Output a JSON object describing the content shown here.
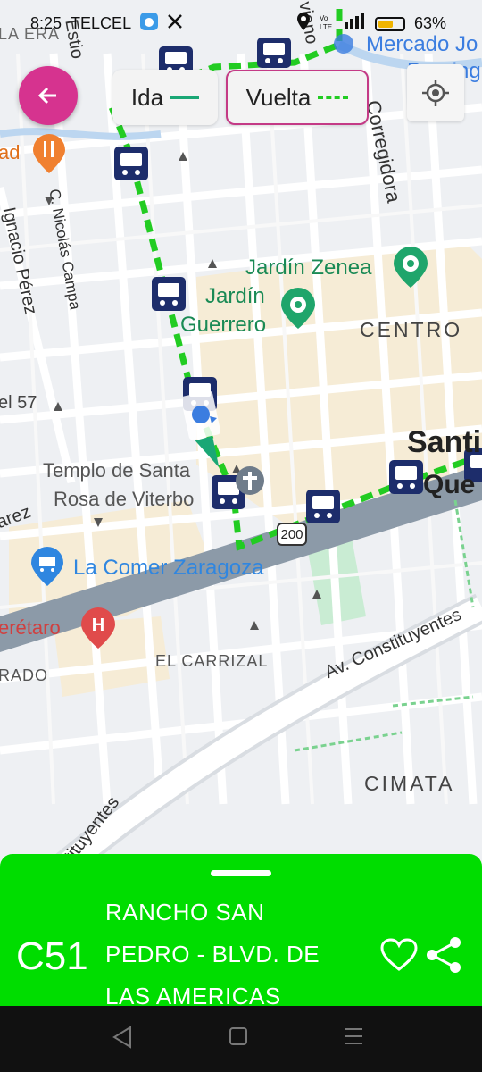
{
  "status_bar": {
    "time": "8:25",
    "carrier": "TELCEL",
    "battery": "63%",
    "battery_level": 0.63
  },
  "header": {
    "back_icon": "arrow-left-icon",
    "ida_label": "Ida",
    "vuelta_label": "Vuelta",
    "locate_icon": "my-location-icon"
  },
  "map": {
    "labels": {
      "la_era": "LA ERA",
      "mercado_1": "Mercado Jo",
      "mercado_2": "Doming",
      "restaurant_frag": "ad",
      "estio": "Estio",
      "viano": "viano",
      "corregidora": "Corregidora",
      "nicolas_campa": "C. Nicolás Campa",
      "ignacio_perez": "Ignacio Pérez",
      "jardin_zenea": "Jardín Zenea",
      "jardin_guerrero_1": "Jardín",
      "jardin_guerrero_2": "Guerrero",
      "centro": "CENTRO",
      "el_57": "el 57",
      "santi": "Santi",
      "que": "Que",
      "templo_1": "Templo de Santa",
      "templo_2": "Rosa de Viterbo",
      "arez": "arez",
      "road_200": "200",
      "la_comer": "La Comer Zaragoza",
      "eretaro": "erétaro",
      "rado": "RADO",
      "el_carrizal": "EL CARRIZAL",
      "av_constituyentes": "Av. Constituyentes",
      "constituyentes_lower": "stituyentes",
      "cimata": "CIMATA"
    },
    "colors": {
      "ida_line": "#1aa775",
      "vuelta_line": "#22cc22",
      "bus_stop": "#1d2d6b",
      "park": "#1fa56b",
      "hospital": "#e04b4b",
      "shop": "#2f86e0",
      "restaurant": "#f08030"
    }
  },
  "route": {
    "code": "C51",
    "name": "RANCHO SAN PEDRO - BLVD. DE LAS AMERICAS",
    "favorite_icon": "heart-outline-icon",
    "share_icon": "share-icon",
    "color": "#00dd00"
  },
  "nav_bar": {
    "back_icon": "nav-back-icon",
    "home_icon": "nav-home-icon",
    "recents_icon": "nav-recents-icon"
  }
}
